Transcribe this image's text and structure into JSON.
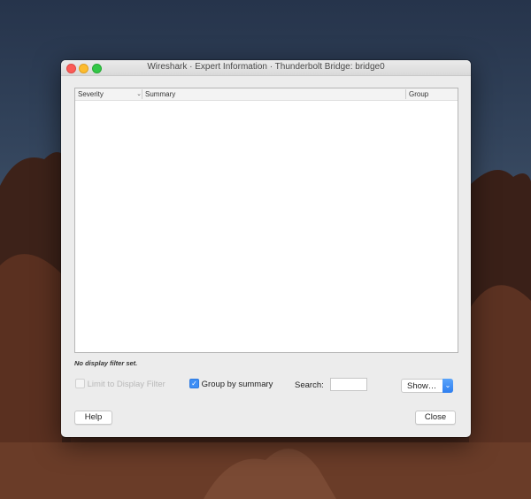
{
  "window": {
    "title": "Wireshark · Expert Information · Thunderbolt Bridge: bridge0"
  },
  "tree": {
    "columns": [
      {
        "label": "Severity",
        "sorted": true
      },
      {
        "label": "Summary"
      },
      {
        "label": "Group"
      }
    ],
    "rows": []
  },
  "status": {
    "text": "No display filter set."
  },
  "controls": {
    "limit_label": "Limit to Display Filter",
    "limit_checked": false,
    "limit_enabled": false,
    "group_label": "Group by summary",
    "group_checked": true,
    "search_label": "Search:",
    "search_value": "",
    "show_label": "Show…"
  },
  "buttons": {
    "help": "Help",
    "close": "Close"
  },
  "colors": {
    "accent": "#3d8ef5"
  }
}
